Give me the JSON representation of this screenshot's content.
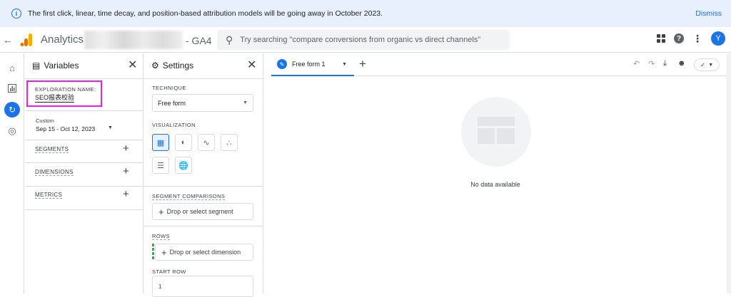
{
  "banner": {
    "icon": "info-icon",
    "message": "The first click, linear, time decay, and position-based attribution models will be going away in October 2023.",
    "dismiss": "Dismiss"
  },
  "header": {
    "app_name": "Analytics",
    "property_suffix": "- GA4",
    "search_placeholder": "Try searching \"compare conversions from organic vs direct channels\"",
    "avatar_letter": "Y"
  },
  "variables": {
    "title": "Variables",
    "exploration_name_label": "EXPLORATION NAME:",
    "exploration_name_value": "SEO报表校验",
    "date_label": "Custom",
    "date_range": "Sep 15 - Oct 12, 2023",
    "segments_label": "SEGMENTS",
    "dimensions_label": "DIMENSIONS",
    "metrics_label": "METRICS"
  },
  "settings": {
    "title": "Settings",
    "technique_label": "TECHNIQUE",
    "technique_value": "Free form",
    "visualization_label": "VISUALIZATION",
    "segment_comparisons_label": "SEGMENT COMPARISONS",
    "drop_segment": "Drop or select segment",
    "rows_label": "ROWS",
    "drop_dimension": "Drop or select dimension",
    "start_row_label": "START ROW",
    "start_row_value": "1"
  },
  "canvas": {
    "tab_label": "Free form 1",
    "empty_message": "No data available"
  },
  "colors": {
    "accent": "#1a73e8",
    "highlight_box": "#e91ef0",
    "banner_bg": "#e8f0fe"
  }
}
